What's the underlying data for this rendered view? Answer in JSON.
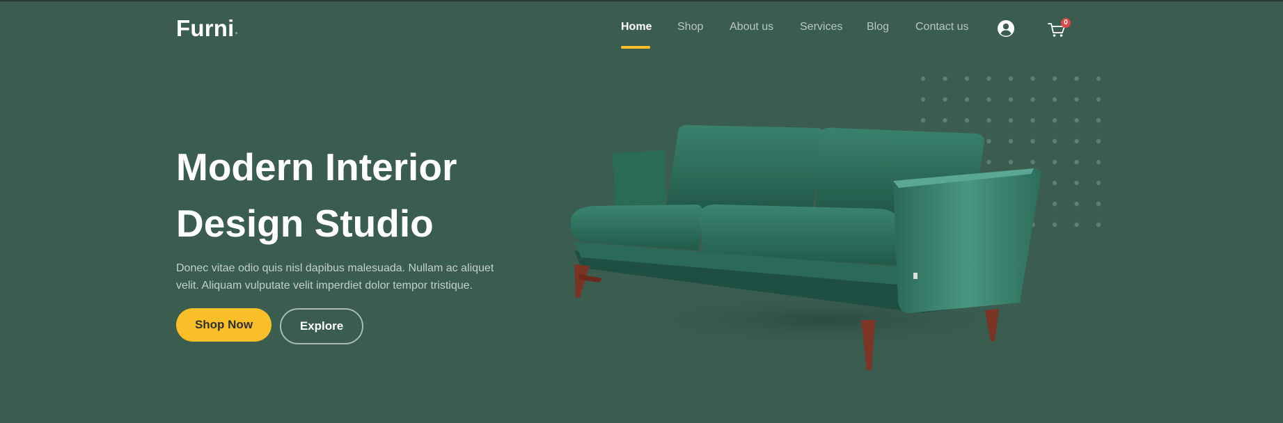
{
  "brand": {
    "name": "Furni"
  },
  "nav": {
    "items": [
      {
        "label": "Home",
        "active": true
      },
      {
        "label": "Shop",
        "active": false
      },
      {
        "label": "About us",
        "active": false
      },
      {
        "label": "Services",
        "active": false
      },
      {
        "label": "Blog",
        "active": false
      },
      {
        "label": "Contact us",
        "active": false
      }
    ],
    "cart_count": "0"
  },
  "hero": {
    "title_line1": "Modern Interior",
    "title_line2": "Design Studio",
    "description_line1": "Donec vitae odio quis nisl dapibus malesuada. Nullam ac aliquet",
    "description_line2": "velit. Aliquam vulputate velit imperdiet dolor tempor tristique.",
    "shop_now_label": "Shop Now",
    "explore_label": "Explore"
  },
  "colors": {
    "background": "#3b5d50",
    "accent": "#f9bf29",
    "badge": "#e04848",
    "sofa": "#2f6f5c"
  },
  "icons": [
    "user-icon",
    "cart-icon",
    "sofa-image"
  ]
}
